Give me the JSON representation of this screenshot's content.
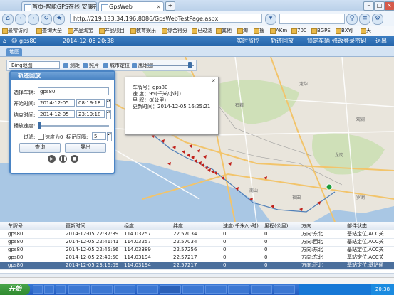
{
  "browser": {
    "tabs": [
      {
        "label": "首页-智能GPS在线|安康在"
      },
      {
        "label": "GpsWeb"
      }
    ],
    "url": "http://219.133.34.196:8086/GpsWebTestPage.aspx",
    "bookmarks": [
      "最常访问",
      "查询大全",
      "产品淘宝",
      "产品项目",
      "教育娱乐",
      "综合得分",
      "已过滤",
      "其他",
      "淘",
      "搜",
      "AKm",
      "700",
      "BGPS",
      "BXYJ",
      "天"
    ]
  },
  "app": {
    "user": "gps80",
    "datetime": "2014-12-06 20:38",
    "header_links": [
      "实时监控",
      "轨迹回放",
      "锁定车辆",
      "修改登录密码",
      "退出"
    ],
    "tab": "地图"
  },
  "map": {
    "map_type": "Bing地图",
    "tools": [
      "测距",
      "照片",
      "城市定位",
      "鹰眼图"
    ]
  },
  "playback": {
    "title": "轨迹回放",
    "vehicle_label": "选择车辆:",
    "vehicle_value": "gps80",
    "start_label": "开始时间:",
    "start_date": "2014-12-05",
    "start_time": "08:19:18",
    "end_label": "结束时间:",
    "end_date": "2014-12-05",
    "end_time": "23:19:18",
    "speed_label": "播放速度:",
    "filter_label": "过滤:",
    "filter_speed": "速度为0",
    "mark_label": "标记间隔:",
    "mark_value": "5",
    "query_button": "查询",
    "export_button": "导出"
  },
  "popup": {
    "rows": [
      "车牌号：gps80",
      "速  度：95(千米/小时)",
      "里  程：0(公里)",
      "更新时间：2014-12-05 16:25:21"
    ]
  },
  "table": {
    "headers": [
      "车牌号",
      "更新时间",
      "经度",
      "纬度",
      "速度(千米/小时)",
      "里程(公里)",
      "方向",
      "部件状态"
    ],
    "rows": [
      [
        "gps80",
        "2014-12-05 22:37:39",
        "114.03257",
        "22.57034",
        "0",
        "0",
        "方向:东北",
        "基站定位,ACC关"
      ],
      [
        "gps80",
        "2014-12-05 22:41:41",
        "114.03257",
        "22.57034",
        "0",
        "0",
        "方向:西北",
        "基站定位,ACC关"
      ],
      [
        "gps80",
        "2014-12-05 22:45:56",
        "114.03389",
        "22.57256",
        "0",
        "0",
        "方向:东北",
        "基站定位,ACC关"
      ],
      [
        "gps80",
        "2014-12-05 22:49:50",
        "114.03194",
        "22.57217",
        "0",
        "0",
        "方向:东北",
        "基站定位,ACC关"
      ],
      [
        "gps80",
        "2014-12-05 23:16:09",
        "114.03194",
        "22.57217",
        "0",
        "0",
        "方向:正北",
        "基站定位,基站通"
      ]
    ]
  },
  "taskbar": {
    "start": "开始",
    "clock": "20:38"
  },
  "colors": {
    "accent": "#2565aa",
    "selected_row": "#4b6f9c",
    "track_marker": "#c0201a"
  }
}
